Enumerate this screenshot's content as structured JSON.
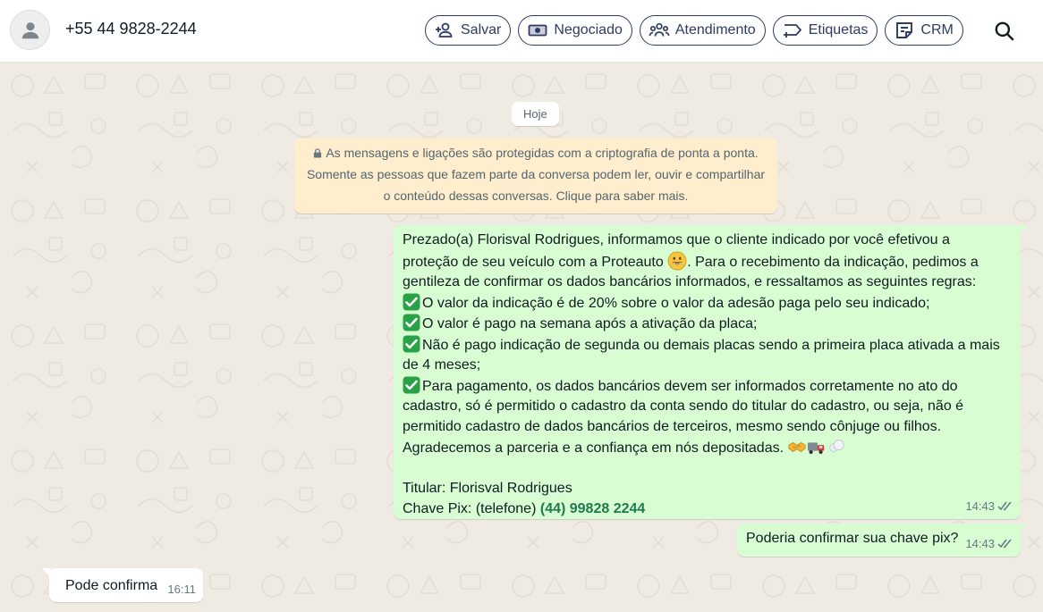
{
  "header": {
    "contact_phone": "+55 44 9828-2244",
    "actions": [
      {
        "label": "Salvar",
        "icon": "add-person-icon"
      },
      {
        "label": "Negociado",
        "icon": "money-icon"
      },
      {
        "label": "Atendimento",
        "icon": "group-icon"
      },
      {
        "label": "Etiquetas",
        "icon": "label-icon"
      },
      {
        "label": "CRM",
        "icon": "note-icon"
      }
    ],
    "search_icon": "search-icon"
  },
  "chat": {
    "date_chip": "Hoje",
    "encryption_notice": {
      "line1": "As mensagens e ligações são protegidas com a criptografia de ponta a ponta.",
      "line2": "Somente as pessoas que fazem parte da conversa podem ler, ouvir e compartilhar",
      "line3": "o conteúdo dessas conversas. Clique para saber mais."
    },
    "messages": [
      {
        "direction": "outgoing",
        "lines": {
          "l1": "Prezado(a) Florisval Rodrigues, informamos que o cliente indicado por você efetivou a",
          "l2a": "proteção de seu veículo com a Proteauto ",
          "l2b": ". Para o recebimento da indicação, pedimos a",
          "l3": "gentileza de confirmar os dados bancários informados, e  ressaltamos as seguintes regras:",
          "l4": "O valor da indicação é de 20% sobre o valor da adesão paga pelo seu indicado;",
          "l5": "O valor é pago na semana após a ativação da placa;",
          "l6": "Não é pago indicação de segunda ou demais placas sendo a primeira placa ativada a mais",
          "l7": "de 4 meses;",
          "l8": "Para pagamento, os dados bancários devem ser informados corretamente no ato do",
          "l9": "cadastro, só é permitido o cadastro da conta sendo do titular do cadastro, ou seja, não é",
          "l10": "permitido cadastro de dados bancários de terceiros, mesmo sendo cônjuge ou filhos.",
          "l11": "Agradecemos a parceria e a confiança em nós depositadas. ",
          "l12": "Titular: Florisval Rodrigues",
          "l13a": "Chave Pix: (telefone)  ",
          "l13b": "(44) 99828 2244"
        },
        "time": "14:43",
        "status": "read"
      },
      {
        "direction": "outgoing",
        "text": "Poderia confirmar sua chave pix?",
        "time": "14:43",
        "status": "read"
      },
      {
        "direction": "incoming",
        "text": "Pode confirma",
        "time": "16:11"
      }
    ]
  },
  "colors": {
    "outgoing_bubble": "#d9fdd3",
    "incoming_bubble": "#ffffff",
    "chat_background": "#efeae2",
    "notice_background": "#ffeecd",
    "header_accent": "#2f3a63",
    "pix_link": "#1f7a4d",
    "check_emoji": "#2aa146"
  }
}
